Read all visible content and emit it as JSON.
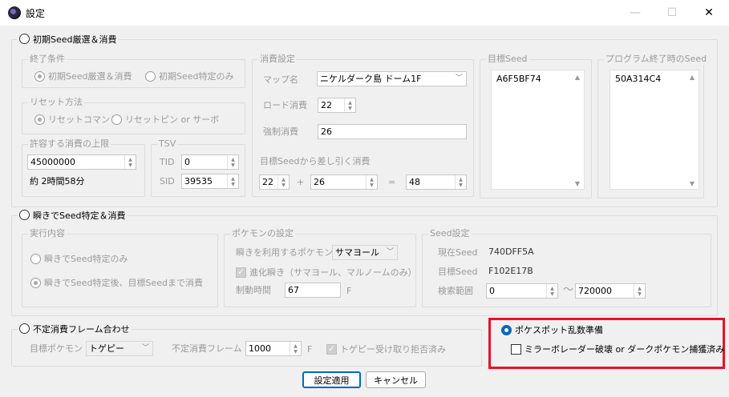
{
  "window": {
    "title": "設定",
    "minimize_symbol": "—",
    "maximize_symbol": "☐",
    "close_symbol": "✕"
  },
  "section1": {
    "title": "初期Seed厳選＆消費",
    "end_condition": {
      "title": "終了条件",
      "option1": "初期Seed厳選＆消費",
      "option2": "初期Seed特定のみ"
    },
    "reset_method": {
      "title": "リセット方法",
      "option1": "リセットコマンド",
      "option2": "リセットピン or サーボ"
    },
    "limit": {
      "title": "許容する消費の上限",
      "value": "45000000",
      "approx": "約 2時間58分"
    },
    "tsv": {
      "title": "TSV",
      "tid_label": "TID",
      "tid_value": "0",
      "sid_label": "SID",
      "sid_value": "39535"
    },
    "consumption": {
      "title": "消費設定",
      "map_label": "マップ名",
      "map_value": "ニケルダーク島 ドーム1F",
      "load_label": "ロード消費",
      "load_value": "22",
      "force_label": "強制消費",
      "force_value": "26",
      "subtract_label": "目標Seedから差し引く消費",
      "sub_a": "22",
      "plus": "+",
      "sub_b": "26",
      "equals": "=",
      "sub_result": "48"
    },
    "target_seed": {
      "title": "目標Seed",
      "value": "A6F5BF74"
    },
    "end_seed": {
      "title": "プログラム終了時のSeed",
      "value": "50A314C4"
    }
  },
  "section2": {
    "title": "瞬きでSeed特定＆消費",
    "exec": {
      "title": "実行内容",
      "option1": "瞬きでSeed特定のみ",
      "option2": "瞬きでSeed特定後、目標Seedまで消費"
    },
    "pokemon": {
      "title": "ポケモンの設定",
      "use_label": "瞬きを利用するポケモン",
      "use_value": "サマヨール",
      "evolve_label": "進化瞬き（サマヨール、マルノームのみ）",
      "control_label": "制動時間",
      "control_value": "67",
      "control_unit": "F"
    },
    "seed": {
      "title": "Seed設定",
      "current_label": "現在Seed",
      "current_value": "740DFF5A",
      "target_label": "目標Seed",
      "target_value": "F102E17B",
      "range_label": "検索範囲",
      "range_from": "0",
      "tilde": "〜",
      "range_to": "720000"
    }
  },
  "section3": {
    "title": "不定消費フレーム合わせ",
    "target_pokemon_label": "目標ポケモン",
    "target_pokemon_value": "トゲピー",
    "frame_label": "不定消費フレーム",
    "frame_value": "1000",
    "frame_unit": "F",
    "received_label": "トゲピー受け取り拒否済み"
  },
  "section4": {
    "title": "ポケスポット乱数準備",
    "checkbox_label": "ミラーボレーダー破壊 or ダークポケモン捕獲済み"
  },
  "buttons": {
    "apply": "設定適用",
    "cancel": "キャンセル"
  },
  "colors": {
    "accent": "#0067c0",
    "highlight_box": "#e81224",
    "disabled_text": "#9a9a9a"
  }
}
